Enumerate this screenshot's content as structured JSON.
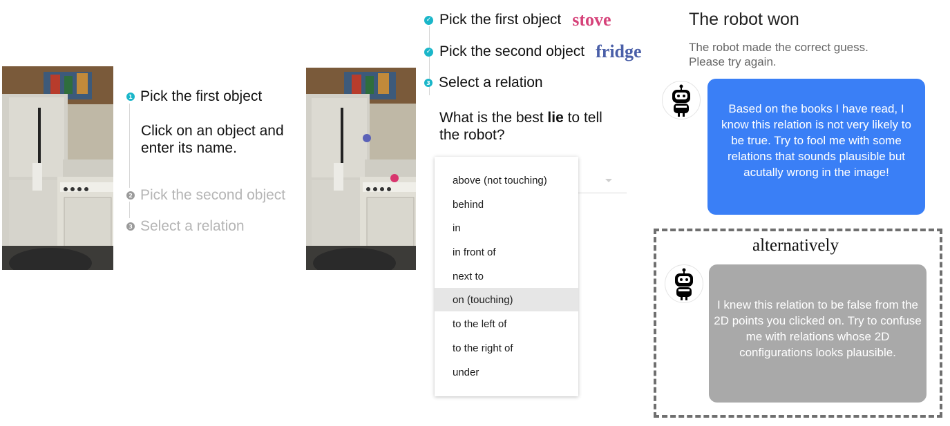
{
  "left_panel": {
    "steps": [
      {
        "number": "1",
        "label": "Pick the first object",
        "state": "active"
      },
      {
        "number": "2",
        "label": "Pick the second object",
        "state": "inactive"
      },
      {
        "number": "3",
        "label": "Select a relation",
        "state": "inactive"
      }
    ],
    "instructions": "Click on an object and enter its name."
  },
  "middle_panel": {
    "steps": [
      {
        "label": "Pick the first object",
        "state": "done",
        "object_name": "stove",
        "object_color": "#d6437a"
      },
      {
        "label": "Pick the second object",
        "state": "done",
        "object_name": "fridge",
        "object_color": "#4a5fa8"
      },
      {
        "number": "3",
        "label": "Select a relation",
        "state": "active"
      }
    ],
    "question_prefix": "What is the best ",
    "question_bold": "lie",
    "question_suffix": " to tell the robot?",
    "relation_options": [
      "above (not touching)",
      "behind",
      "in",
      "in front of",
      "next to",
      "on (touching)",
      "to the left of",
      "to the right of",
      "under"
    ],
    "highlighted_option": "on (touching)"
  },
  "point_markers": [
    {
      "name": "second-object-point",
      "color": "#5b62b8"
    },
    {
      "name": "first-object-point",
      "color": "#d8366e"
    }
  ],
  "result_panel": {
    "title": "The robot won",
    "subtitle_line1": "The robot made the correct guess.",
    "subtitle_line2": "Please try again.",
    "robot_message": "Based on the books I have read, I know this relation is not very likely to be true. Try to fool me with some relations that sounds plausible but acutally wrong in the image!",
    "alternative_label": "alternatively",
    "alternative_message": "I knew this relation to be false from the 2D points you clicked on. Try to confuse me with relations whose 2D configurations looks plausible."
  },
  "colors": {
    "accent_teal": "#1ab6c9",
    "bubble_blue": "#3a7ff6",
    "bubble_gray": "#a9a9a9"
  },
  "icons": {
    "step_check": "check-circle-icon",
    "robot": "robot-avatar-icon",
    "dropdown_caret": "caret-down-icon"
  }
}
